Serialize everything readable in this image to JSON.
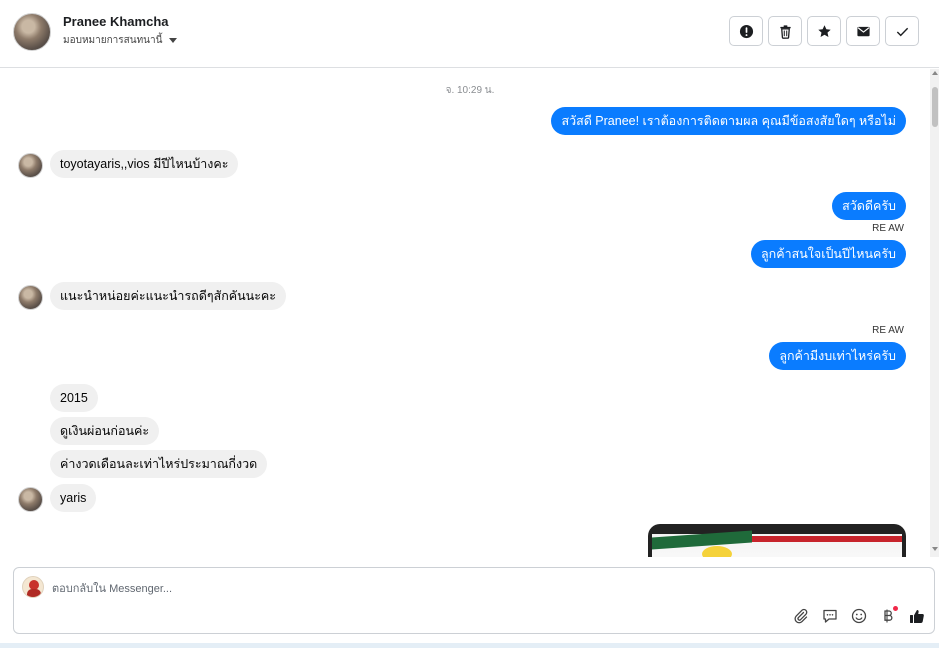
{
  "header": {
    "contact_name": "Pranee Khamcha",
    "assign_label": "มอบหมายการสนทนานี้",
    "actions": [
      {
        "name": "report-button",
        "icon": "alert-circle-icon"
      },
      {
        "name": "delete-button",
        "icon": "trash-icon"
      },
      {
        "name": "star-button",
        "icon": "star-icon"
      },
      {
        "name": "mark-unread-button",
        "icon": "envelope-icon"
      },
      {
        "name": "mark-done-button",
        "icon": "check-icon"
      }
    ]
  },
  "messages": {
    "timestamp": "จ. 10:29 น.",
    "m1": "สวัสดี Pranee! เราต้องการติดตามผล คุณมีข้อสงสัยใดๆ หรือไม่",
    "m2": "toyotayaris,,vios มีปีไหนบ้างคะ",
    "m3": "สวัดดีครับ",
    "sender1": "RE AW",
    "m4": "ลูกค้าสนใจเป็นปีไหนครับ",
    "m5": "แนะนำหน่อยค่ะแนะนำรถดีๆสักคันนะคะ",
    "sender2": "RE AW",
    "m6": "ลูกค้ามีงบเท่าไหร่ครับ",
    "m7": "2015",
    "m8": "ดูเงินผ่อนก่อนค่ะ",
    "m9": "ค่างวดเดือนละเท่าไหร่ประมาณกี่งวด",
    "m10": "yaris"
  },
  "composer": {
    "placeholder": "ตอบกลับใน Messenger..."
  },
  "colors": {
    "outgoing_bubble": "#0a7cff",
    "incoming_bubble": "#f0f0f0",
    "like_icon": "#1c1e21"
  }
}
